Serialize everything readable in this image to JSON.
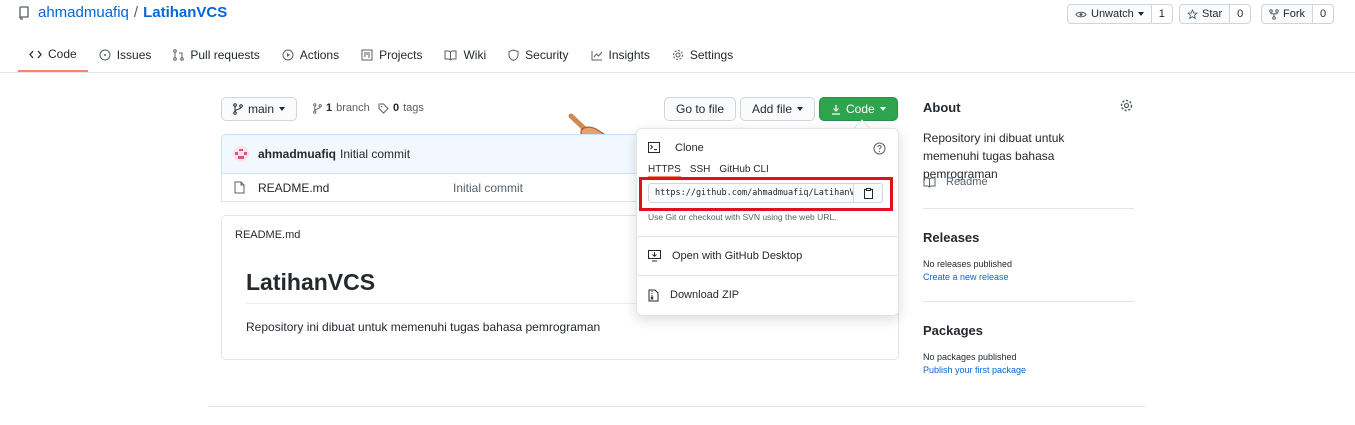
{
  "repo": {
    "owner": "ahmadmuafiq",
    "separator": "/",
    "name": "LatihanVCS"
  },
  "actions": {
    "watch": {
      "label": "Unwatch",
      "count": "1"
    },
    "star": {
      "label": "Star",
      "count": "0"
    },
    "fork": {
      "label": "Fork",
      "count": "0"
    }
  },
  "tabs": [
    {
      "label": "Code",
      "icon": "code-icon",
      "active": true
    },
    {
      "label": "Issues",
      "icon": "issue-icon"
    },
    {
      "label": "Pull requests",
      "icon": "pull-request-icon"
    },
    {
      "label": "Actions",
      "icon": "play-icon"
    },
    {
      "label": "Projects",
      "icon": "project-icon"
    },
    {
      "label": "Wiki",
      "icon": "book-icon"
    },
    {
      "label": "Security",
      "icon": "shield-icon"
    },
    {
      "label": "Insights",
      "icon": "graph-icon"
    },
    {
      "label": "Settings",
      "icon": "gear-icon"
    }
  ],
  "branch_bar": {
    "branch": "main",
    "branches_count": "1",
    "branches_label": "branch",
    "tags_count": "0",
    "tags_label": "tags",
    "go_to_file": "Go to file",
    "add_file": "Add file",
    "code": "Code"
  },
  "commit": {
    "author": "ahmadmuafiq",
    "message": "Initial commit"
  },
  "files": [
    {
      "name": "README.md",
      "commit": "Initial commit"
    }
  ],
  "readme": {
    "filename": "README.md",
    "title": "LatihanVCS",
    "body": "Repository ini dibuat untuk memenuhi tugas bahasa pemrograman"
  },
  "clone": {
    "title": "Clone",
    "tabs": [
      "HTTPS",
      "SSH",
      "GitHub CLI"
    ],
    "url": "https://github.com/ahmadmuafiq/LatihanVCS.git",
    "hint": "Use Git or checkout with SVN using the web URL.",
    "desktop": "Open with GitHub Desktop",
    "zip": "Download ZIP"
  },
  "about": {
    "title": "About",
    "description": "Repository ini dibuat untuk memenuhi tugas bahasa pemrograman",
    "readme_link": "Readme"
  },
  "releases": {
    "title": "Releases",
    "empty": "No releases published",
    "link": "Create a new release"
  },
  "packages": {
    "title": "Packages",
    "empty": "No packages published",
    "link": "Publish your first package"
  },
  "colors": {
    "accent": "#0366d6",
    "green": "#2ea44f",
    "tab_underline": "#f9826c",
    "highlight": "#e0111f"
  }
}
